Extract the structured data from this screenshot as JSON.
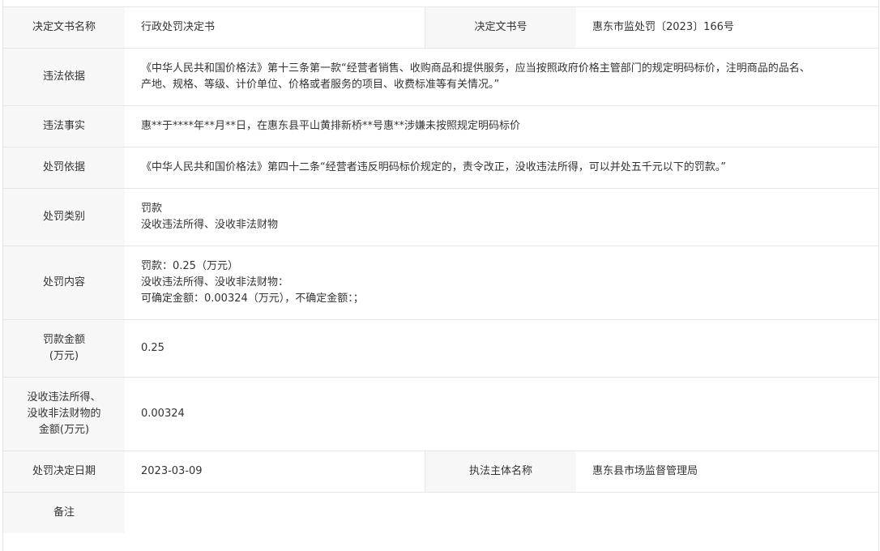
{
  "rows": {
    "doc_name": {
      "label": "决定文书名称",
      "value": "行政处罚决定书",
      "label2": "决定文书号",
      "value2": "惠东市监处罚〔2023〕166号"
    },
    "basis": {
      "label": "违法依据",
      "line1": "《中华人民共和国价格法》第十三条第一款“经营者销售、收购商品和提供服务，应当按照政府价格主管部门的规定明码标价，注明商品的品名、",
      "line2": "产地、规格、等级、计价单位、价格或者服务的项目、收费标准等有关情况。”"
    },
    "facts": {
      "label": "违法事实",
      "value": "惠**于****年**月**日，在惠东县平山黄排新桥**号惠**涉嫌未按照规定明码标价"
    },
    "penalty_basis": {
      "label": "处罚依据",
      "value": "《中华人民共和国价格法》第四十二条“经营者违反明码标价规定的，责令改正，没收违法所得，可以并处五千元以下的罚款。”"
    },
    "penalty_type": {
      "label": "处罚类别",
      "line1": "罚款",
      "line2": "没收违法所得、没收非法财物"
    },
    "penalty_content": {
      "label": "处罚内容",
      "line1": "罚款：0.25（万元）",
      "line2": "没收违法所得、没收非法财物：",
      "line3": "可确定金额：0.00324（万元），不确定金额：；"
    },
    "fine_amount": {
      "label_line1": "罚款金额",
      "label_line2": "(万元)",
      "value": "0.25"
    },
    "confiscation": {
      "label_line1": "没收违法所得、",
      "label_line2": "没收非法财物的",
      "label_line3": "金额(万元)",
      "value": "0.00324"
    },
    "decision_date": {
      "label": "处罚决定日期",
      "value": "2023-03-09",
      "label2": "执法主体名称",
      "value2": "惠东县市场监督管理局"
    },
    "remarks": {
      "label": "备注",
      "value": ""
    }
  }
}
